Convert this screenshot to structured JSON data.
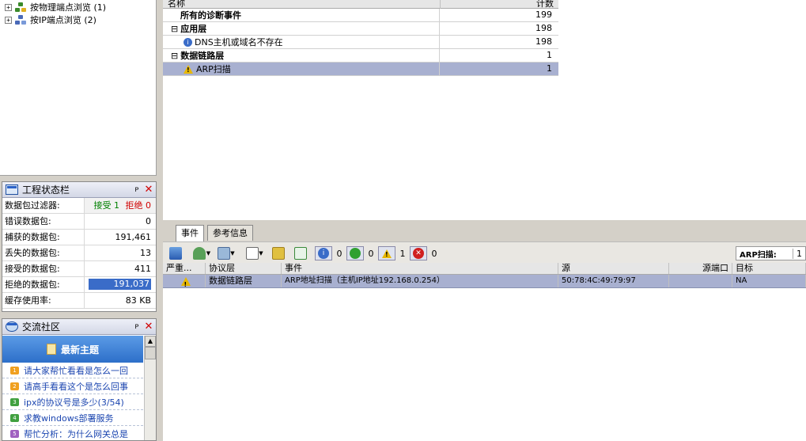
{
  "tree": {
    "items": [
      {
        "expander": "+",
        "label": "按物理端点浏览 (1)"
      },
      {
        "expander": "+",
        "label": "按IP端点浏览 (2)"
      }
    ]
  },
  "status_panel": {
    "title": "工程状态栏",
    "pin": "ᴘ",
    "close": "✕",
    "filter_label": "数据包过滤器:",
    "filter_accept": "接受 1",
    "filter_reject": "拒绝 0",
    "rows": [
      {
        "label": "错误数据包:",
        "value": "0"
      },
      {
        "label": "捕获的数据包:",
        "value": "191,461"
      },
      {
        "label": "丢失的数据包:",
        "value": "13"
      },
      {
        "label": "接受的数据包:",
        "value": "411"
      },
      {
        "label": "拒绝的数据包:",
        "value": "191,037"
      },
      {
        "label": "缓存使用率:",
        "value": "83 KB"
      }
    ],
    "rejected_fraction": 0.99
  },
  "community": {
    "title": "交流社区",
    "pin": "ᴘ",
    "close": "✕",
    "header": "最新主题",
    "items": [
      {
        "num": "1",
        "text": "请大家帮忙看看是怎么一回"
      },
      {
        "num": "2",
        "text": "请高手看看这个是怎么回事"
      },
      {
        "num": "3",
        "text": "ipx的协议号是多少(3/54)"
      },
      {
        "num": "4",
        "text": "求教windows部署服务"
      },
      {
        "num": "5",
        "text": "帮忙分析：为什么网关总是"
      }
    ]
  },
  "diag_grid": {
    "col_name": "名称",
    "col_count": "计数",
    "rows": [
      {
        "label": "所有的诊断事件",
        "count": "199",
        "level": 0,
        "bold": true
      },
      {
        "label": "应用层",
        "count": "198",
        "level": 1,
        "bold": true,
        "expander": "⊟"
      },
      {
        "label": "DNS主机或域名不存在",
        "count": "198",
        "level": 2,
        "icon": "info"
      },
      {
        "label": "数据链路层",
        "count": "1",
        "level": 1,
        "bold": true,
        "expander": "⊟"
      },
      {
        "label": "ARP扫描",
        "count": "1",
        "level": 2,
        "icon": "warn",
        "selected": true
      }
    ]
  },
  "tabs": [
    {
      "label": "事件"
    },
    {
      "label": "参考信息"
    }
  ],
  "toolbar": {
    "info_count": "0",
    "ok_count": "0",
    "warn_count": "1",
    "error_count": "0",
    "filter_label": "ARP扫描:",
    "filter_value": "1"
  },
  "event_grid": {
    "headers": [
      "严重...",
      "协议层",
      "事件",
      "源",
      "源端口",
      "目标"
    ],
    "rows": [
      {
        "severity": "warn",
        "layer": "数据链路层",
        "event": "ARP地址扫描（主机IP地址192.168.0.254）",
        "source": "50:78:4C:49:79:97",
        "port": "",
        "target": "NA"
      }
    ]
  },
  "colors": {
    "accent": "#2d6fc9",
    "selection": "#a8b0d0",
    "accept": "#008000",
    "reject": "#d00000"
  }
}
